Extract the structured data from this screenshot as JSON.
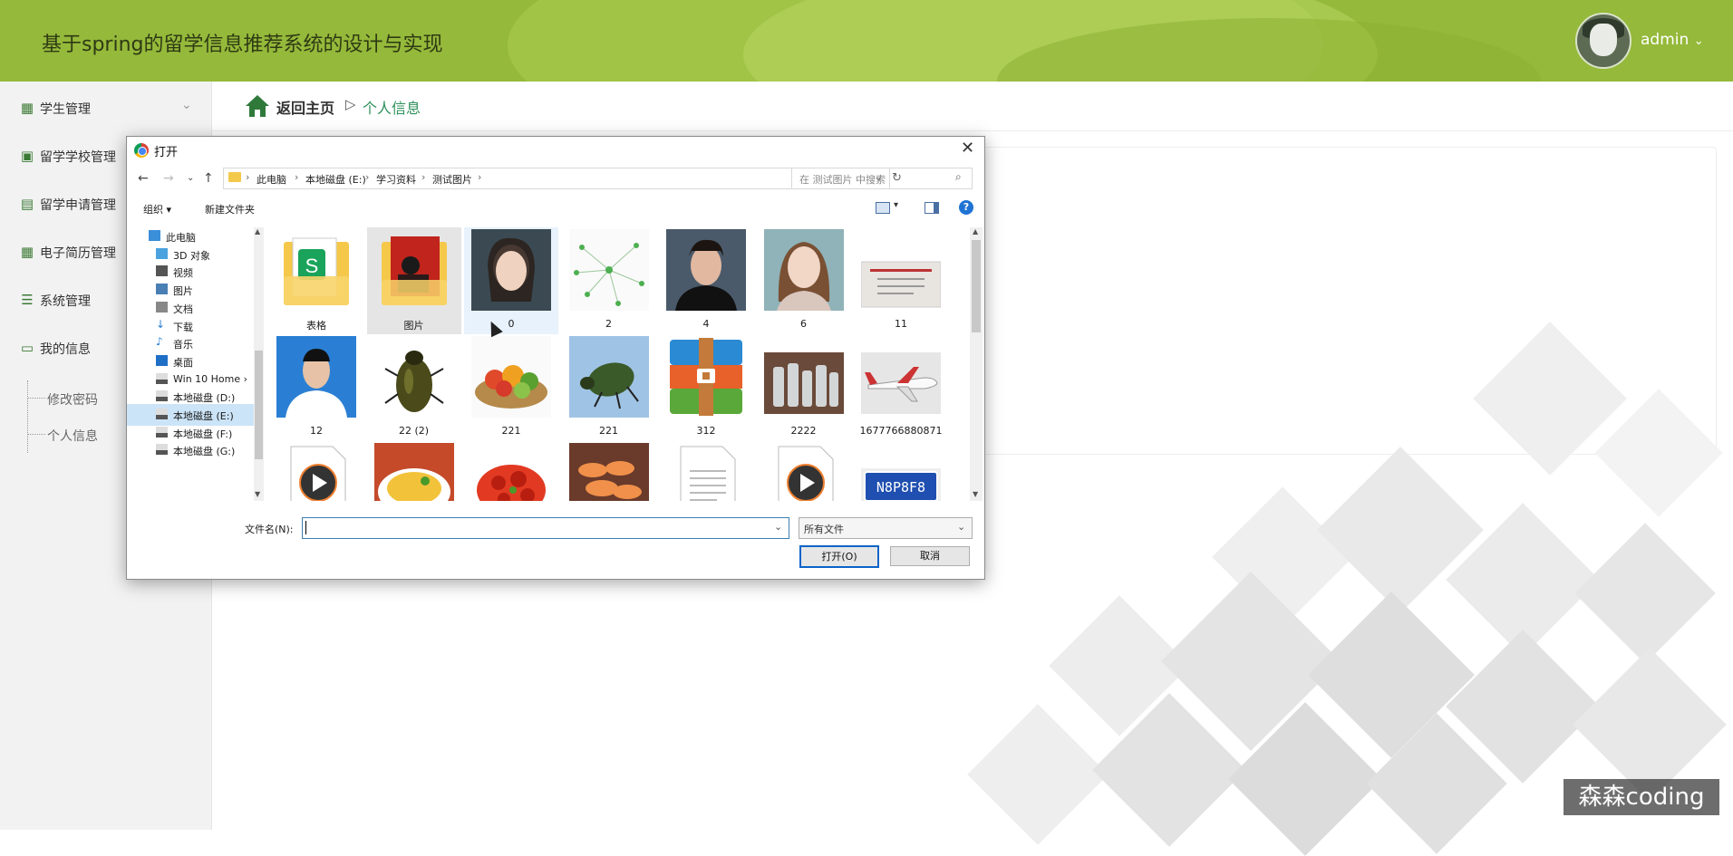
{
  "header": {
    "title": "基于spring的留学信息推荐系统的设计与实现",
    "user": "admin",
    "user_caret": "⌄"
  },
  "sidebar": {
    "items": [
      {
        "label": "学生管理",
        "icon": "grid-icon",
        "glyph": "▦",
        "arrow": "⌄"
      },
      {
        "label": "留学学校管理",
        "icon": "clipboard-icon",
        "glyph": "▣"
      },
      {
        "label": "留学申请管理",
        "icon": "ticket-icon",
        "glyph": "▤"
      },
      {
        "label": "电子简历管理",
        "icon": "grid-icon",
        "glyph": "▦"
      },
      {
        "label": "系统管理",
        "icon": "list-icon",
        "glyph": "☰"
      },
      {
        "label": "我的信息",
        "icon": "card-icon",
        "glyph": "▭"
      }
    ],
    "subitems": [
      {
        "label": "修改密码"
      },
      {
        "label": "个人信息"
      }
    ]
  },
  "breadcrumb": {
    "home": "返回主页",
    "separator": "▷",
    "current": "个人信息"
  },
  "watermark": "森森coding",
  "dialog": {
    "title": "打开",
    "close_glyph": "✕",
    "nav": {
      "back": "←",
      "forward": "→",
      "recent": "⌄",
      "up": "↑"
    },
    "address": [
      "此电脑",
      "本地磁盘 (E:)",
      "学习资料",
      "测试图片"
    ],
    "address_sep": "›",
    "address_dropdown": "⌄",
    "refresh_glyph": "↻",
    "search_placeholder": "在 测试图片 中搜索",
    "search_glyph": "⌕",
    "toolbar": {
      "organize": "组织 ▾",
      "new_folder": "新建文件夹",
      "view_dd": "▾",
      "help": "?"
    },
    "tree": [
      {
        "label": "此电脑",
        "icon": "computer-icon"
      },
      {
        "label": "3D 对象",
        "icon": "cube-icon"
      },
      {
        "label": "视频",
        "icon": "video-icon"
      },
      {
        "label": "图片",
        "icon": "picture-icon"
      },
      {
        "label": "文档",
        "icon": "document-icon"
      },
      {
        "label": "下载",
        "icon": "download-icon"
      },
      {
        "label": "音乐",
        "icon": "music-icon"
      },
      {
        "label": "桌面",
        "icon": "desktop-icon"
      },
      {
        "label": "Win 10 Home ›",
        "icon": "drive-icon"
      },
      {
        "label": "本地磁盘 (D:)",
        "icon": "drive-icon"
      },
      {
        "label": "本地磁盘 (E:)",
        "icon": "drive-icon"
      },
      {
        "label": "本地磁盘 (F:)",
        "icon": "drive-icon"
      },
      {
        "label": "本地磁盘 (G:)",
        "icon": "drive-icon"
      }
    ],
    "files": [
      {
        "name": "表格",
        "kind": "folder-sheet"
      },
      {
        "name": "图片",
        "kind": "folder-photo"
      },
      {
        "name": "0",
        "kind": "portrait"
      },
      {
        "name": "2",
        "kind": "graph"
      },
      {
        "name": "4",
        "kind": "portrait-man"
      },
      {
        "name": "6",
        "kind": "portrait-woman"
      },
      {
        "name": "11",
        "kind": "certificate"
      },
      {
        "name": "12",
        "kind": "id-photo"
      },
      {
        "name": "22 (2)",
        "kind": "beetle"
      },
      {
        "name": "221",
        "kind": "vegetables"
      },
      {
        "name": "221",
        "kind": "beetle-blue"
      },
      {
        "name": "312",
        "kind": "archive"
      },
      {
        "name": "2222",
        "kind": "bottles"
      },
      {
        "name": "1677766880871",
        "kind": "airplane"
      },
      {
        "name": "",
        "kind": "video"
      },
      {
        "name": "",
        "kind": "food-yellow"
      },
      {
        "name": "",
        "kind": "crayfish"
      },
      {
        "name": "",
        "kind": "shrimp"
      },
      {
        "name": "",
        "kind": "doc"
      },
      {
        "name": "",
        "kind": "video"
      },
      {
        "name": "",
        "kind": "plate"
      }
    ],
    "plate_text": "N8P8F8",
    "filename_label": "文件名(N):",
    "filename_value": "",
    "filetype": "所有文件",
    "open_button": "打开(O)",
    "cancel_button": "取消"
  }
}
